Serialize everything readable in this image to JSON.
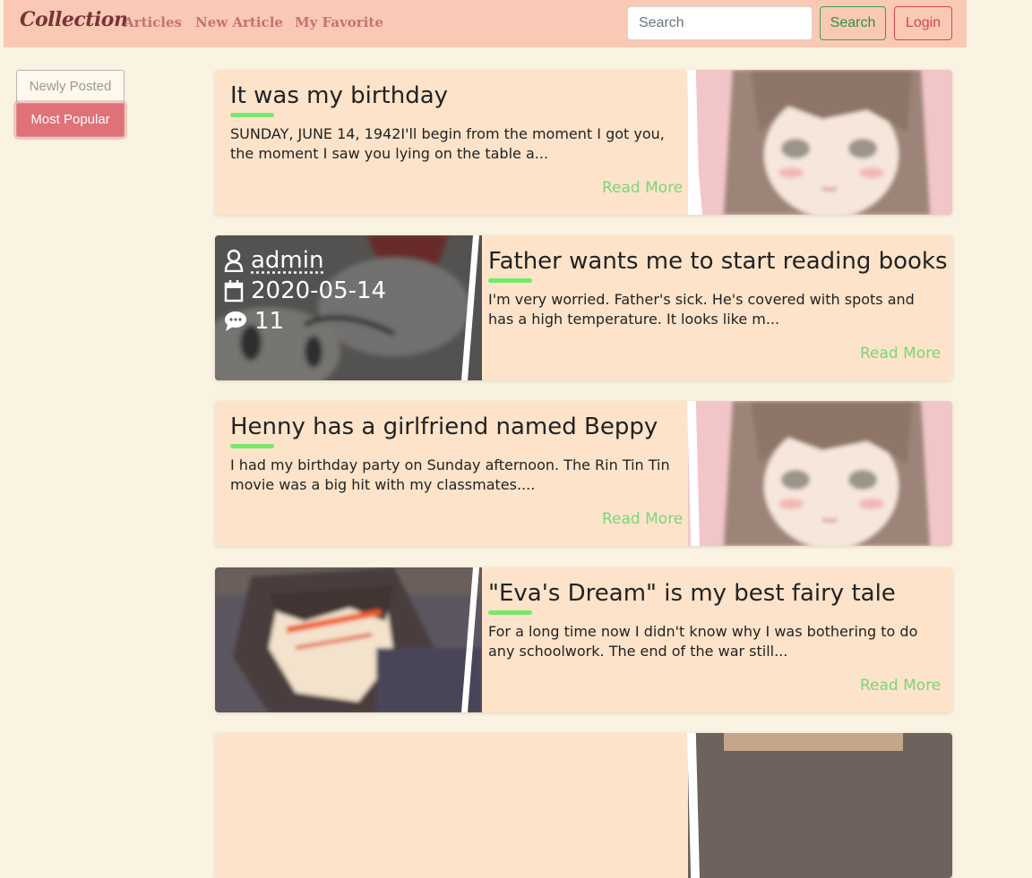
{
  "navbar": {
    "brand": "Collection",
    "links": [
      "Articles",
      "New Article",
      "My Favorite"
    ],
    "search_placeholder": "Search",
    "search_button": "Search",
    "login_button": "Login"
  },
  "sidebar": {
    "items": [
      "Newly Posted",
      "Most Popular"
    ],
    "active": "Most Popular"
  },
  "articles": [
    {
      "title": "It was my birthday",
      "excerpt": "SUNDAY, JUNE 14, 1942I'll begin from the moment I got you, the moment I saw you lying on the table a...",
      "read_more": "Read More",
      "image": "anime-girl-portrait"
    },
    {
      "title": "Father wants me to start reading books",
      "excerpt": "I'm very worried. Father's sick. He's covered with spots and has a high temperature. It looks like m...",
      "read_more": "Read More",
      "image": "cartoon-creature",
      "meta": {
        "author": "admin",
        "date": "2020-05-14",
        "comments": "11"
      }
    },
    {
      "title": "Henny has a girlfriend named Beppy",
      "excerpt": "I had my birthday party on Sunday afternoon. The Rin Tin Tin movie was a big hit with my classmates....",
      "read_more": "Read More",
      "image": "anime-girl-portrait"
    },
    {
      "title": "\"Eva's Dream\" is my best fairy tale",
      "excerpt": "For a long time now I didn't know why I was bothering to do any schoolwork. The end of the war still...",
      "read_more": "Read More",
      "image": "anime-boy-glasses"
    }
  ],
  "colors": {
    "page_bg": "#fbf3e1",
    "navbar_bg": "#f9c9b5",
    "card_bg": "#fde3c9",
    "accent_green": "#78e86c",
    "read_more": "#7ad67a",
    "login_red": "#d3454e",
    "search_green": "#2f8f46",
    "popular_bg": "#df7278"
  }
}
